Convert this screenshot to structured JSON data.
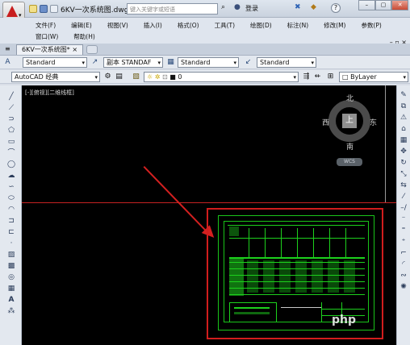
{
  "titlebar": {
    "doc_tab": "6KV一次系统图.dwg",
    "search_placeholder": "键入关键字或短语",
    "login": "登录",
    "help": "?"
  },
  "menu": {
    "row1": [
      "文件(F)",
      "编辑(E)",
      "视图(V)",
      "插入(I)",
      "格式(O)",
      "工具(T)",
      "绘图(D)",
      "标注(N)",
      "修改(M)",
      "参数(P)"
    ],
    "row2": [
      "窗口(W)",
      "帮助(H)"
    ]
  },
  "file_tab": {
    "label": "6KV一次系统图*"
  },
  "styles": {
    "text_style": "Standard",
    "dim_style": "副本 STANDAF",
    "table_style": "Standard",
    "mleader_style": "Standard"
  },
  "workspace": {
    "name": "AutoCAD 经典",
    "layer": "0",
    "color": "ByLayer"
  },
  "viewport": {
    "label": "[-][俯视][二维线框]",
    "north": "北",
    "south": "南",
    "east": "东",
    "west": "西",
    "top": "上",
    "wcs": "WCS"
  },
  "watermark": "php",
  "colors": {
    "drawing_green": "#1dd11d",
    "highlight_red": "#d11d1d",
    "canvas": "#000000"
  }
}
